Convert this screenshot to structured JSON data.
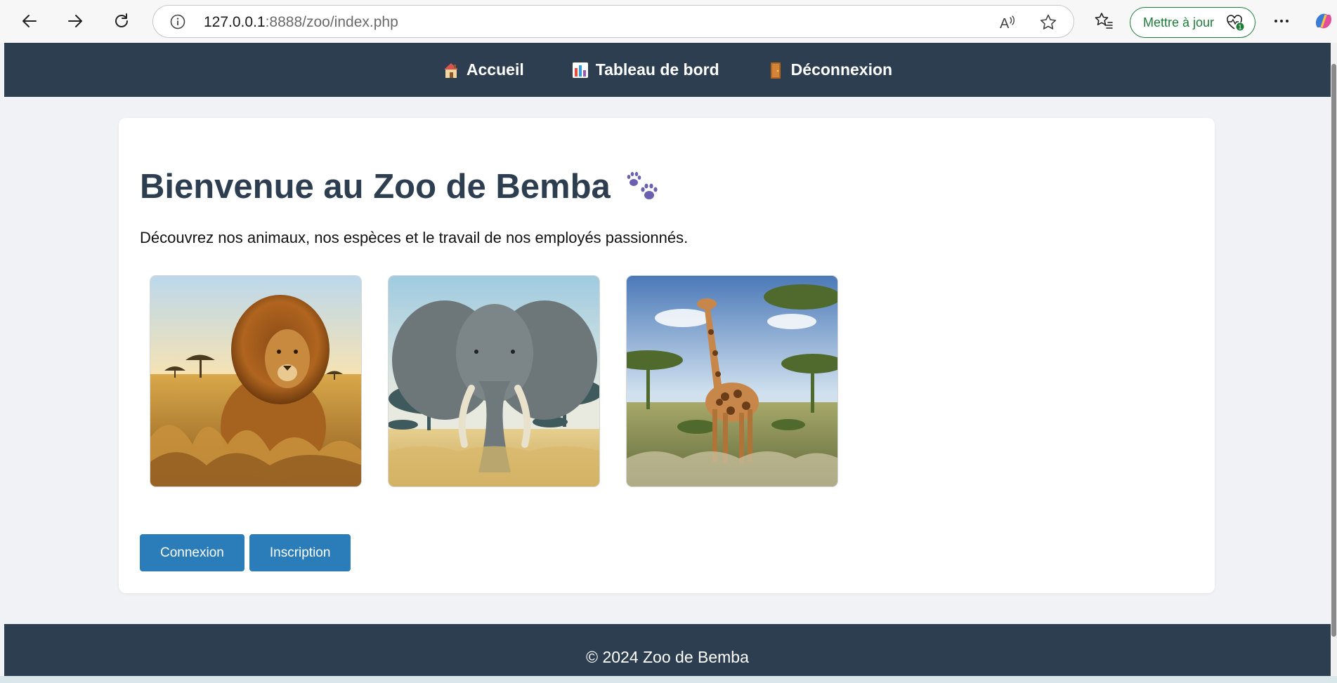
{
  "browser": {
    "url_host": "127.0.0.1",
    "url_rest": ":8888/zoo/index.php",
    "update_label": "Mettre à jour",
    "update_badge": "1"
  },
  "nav": {
    "items": [
      {
        "label": "Accueil",
        "icon": "house-icon"
      },
      {
        "label": "Tableau de bord",
        "icon": "chart-icon"
      },
      {
        "label": "Déconnexion",
        "icon": "door-icon"
      }
    ]
  },
  "main": {
    "title": "Bienvenue au Zoo de Bemba",
    "lead": "Découvrez nos animaux, nos espèces et le travail de nos employés passionnés.",
    "images": [
      {
        "name": "lion-image"
      },
      {
        "name": "elephant-image"
      },
      {
        "name": "giraffe-image"
      }
    ],
    "buttons": {
      "login": "Connexion",
      "register": "Inscription"
    }
  },
  "footer": {
    "text": "© 2024 Zoo de Bemba"
  },
  "colors": {
    "nav_bg": "#2c3e50",
    "button_bg": "#2a7db8",
    "title": "#2c3e50",
    "update_green": "#1e7c3a"
  }
}
